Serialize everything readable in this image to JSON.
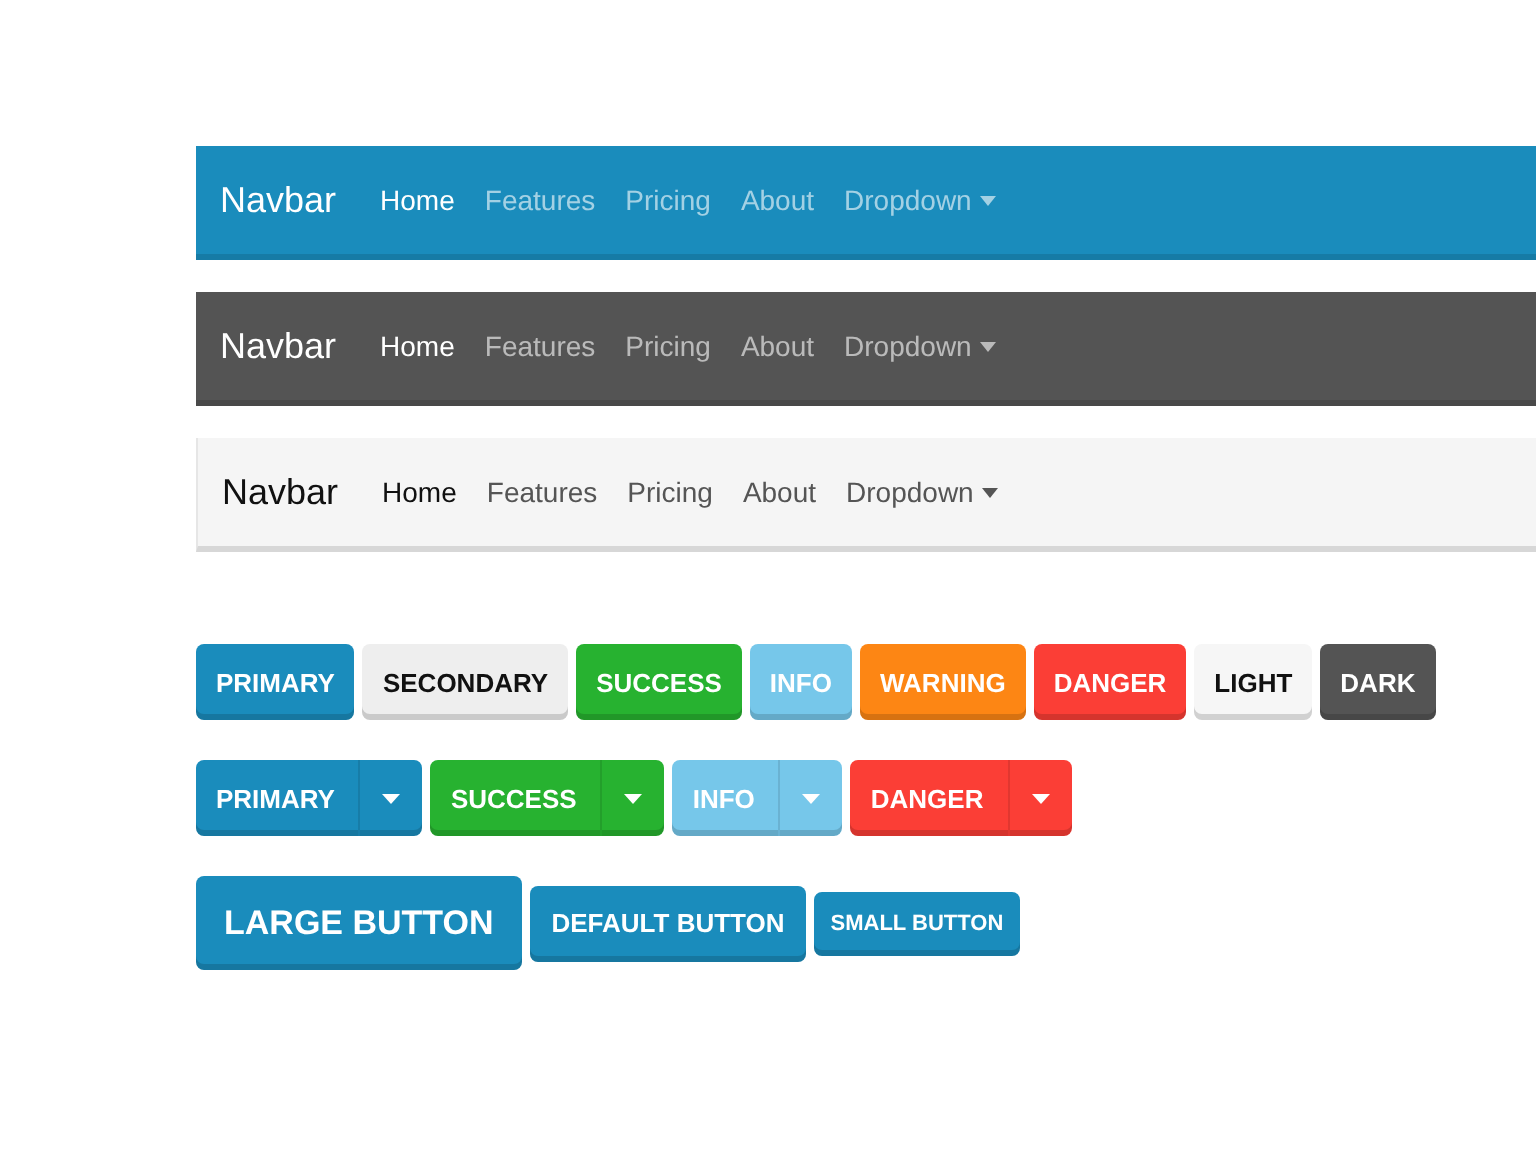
{
  "navbars": [
    {
      "color": "#1a8cbc",
      "brand": "Navbar",
      "items": [
        {
          "label": "Home",
          "selected": true,
          "kind": "link"
        },
        {
          "label": "Features",
          "selected": false,
          "kind": "link"
        },
        {
          "label": "Pricing",
          "selected": false,
          "kind": "link"
        },
        {
          "label": "About",
          "selected": false,
          "kind": "link"
        },
        {
          "label": "Dropdown",
          "selected": false,
          "kind": "dropdown"
        }
      ]
    },
    {
      "color": "#545454",
      "brand": "Navbar",
      "items": [
        {
          "label": "Home",
          "selected": true,
          "kind": "link"
        },
        {
          "label": "Features",
          "selected": false,
          "kind": "link"
        },
        {
          "label": "Pricing",
          "selected": false,
          "kind": "link"
        },
        {
          "label": "About",
          "selected": false,
          "kind": "link"
        },
        {
          "label": "Dropdown",
          "selected": false,
          "kind": "dropdown"
        }
      ]
    },
    {
      "color": "#f5f5f5",
      "brand": "Navbar",
      "items": [
        {
          "label": "Home",
          "selected": true,
          "kind": "link"
        },
        {
          "label": "Features",
          "selected": false,
          "kind": "link"
        },
        {
          "label": "Pricing",
          "selected": false,
          "kind": "link"
        },
        {
          "label": "About",
          "selected": false,
          "kind": "link"
        },
        {
          "label": "Dropdown",
          "selected": false,
          "kind": "dropdown"
        }
      ]
    }
  ],
  "buttons": [
    {
      "label": "PRIMARY",
      "color": "#1a8cbc"
    },
    {
      "label": "SECONDARY",
      "color": "#eeeeee"
    },
    {
      "label": "SUCCESS",
      "color": "#27b230"
    },
    {
      "label": "INFO",
      "color": "#76c7ea"
    },
    {
      "label": "WARNING",
      "color": "#fd8614"
    },
    {
      "label": "DANGER",
      "color": "#fb3e36"
    },
    {
      "label": "LIGHT",
      "color": "#f6f6f6"
    },
    {
      "label": "DARK",
      "color": "#545454"
    }
  ],
  "split_buttons": [
    {
      "label": "PRIMARY",
      "color": "#1a8cbc"
    },
    {
      "label": "SUCCESS",
      "color": "#27b230"
    },
    {
      "label": "INFO",
      "color": "#76c7ea"
    },
    {
      "label": "DANGER",
      "color": "#fb3e36"
    }
  ],
  "sized_buttons": [
    {
      "label": "LARGE BUTTON",
      "kind": "large"
    },
    {
      "label": "DEFAULT BUTTON",
      "kind": "default"
    },
    {
      "label": "SMALL BUTTON",
      "kind": "small"
    }
  ]
}
